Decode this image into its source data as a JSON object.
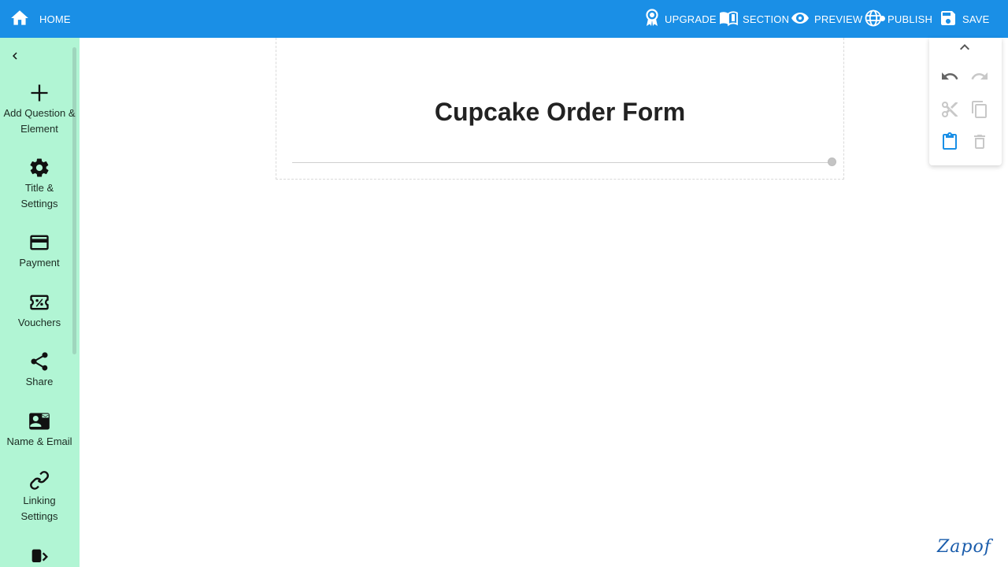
{
  "topbar": {
    "home": "HOME",
    "upgrade": "UPGRADE",
    "section": "SECTION",
    "preview": "PREVIEW",
    "publish": "PUBLISH",
    "save": "SAVE",
    "color": "#1a8fe6"
  },
  "sidebar": {
    "color": "#b1f5d4",
    "items": [
      {
        "label": "Add Question & Element",
        "icon": "plus-icon"
      },
      {
        "label": "Title & Settings",
        "icon": "gear-icon"
      },
      {
        "label": "Payment",
        "icon": "credit-card-icon"
      },
      {
        "label": "Vouchers",
        "icon": "voucher-icon"
      },
      {
        "label": "Share",
        "icon": "share-icon"
      },
      {
        "label": "Name & Email",
        "icon": "contact-mail-icon"
      },
      {
        "label": "Linking Settings",
        "icon": "link-icon"
      }
    ]
  },
  "form": {
    "title": "Cupcake Order Form"
  },
  "tools": {
    "items": [
      "chevron-up-icon",
      "undo-icon",
      "redo-icon",
      "cut-icon",
      "copy-icon",
      "paste-icon",
      "delete-icon"
    ]
  },
  "logo": {
    "text": "Zapof"
  }
}
